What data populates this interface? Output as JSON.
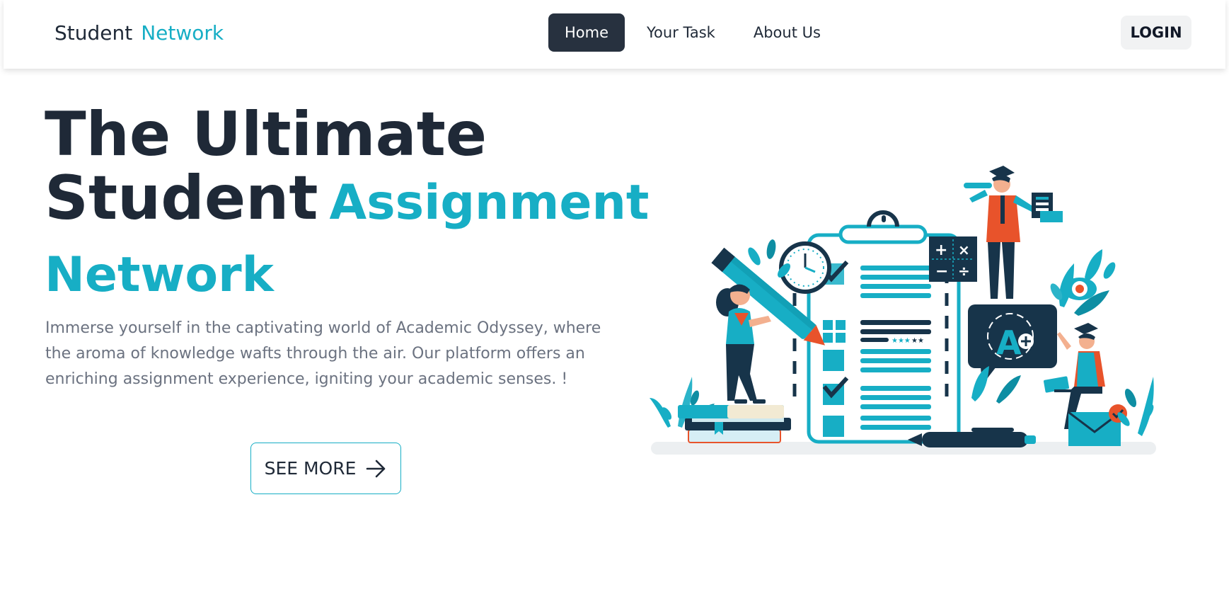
{
  "brand": {
    "part1": "Student",
    "part2": "Network"
  },
  "nav": {
    "items": [
      {
        "label": "Home",
        "active": true
      },
      {
        "label": "Your Task",
        "active": false
      },
      {
        "label": "About Us",
        "active": false
      }
    ]
  },
  "login": {
    "label": "LOGIN"
  },
  "hero": {
    "title_line1": "The Ultimate",
    "title_line2_dark": "Student",
    "title_line2_accent": "Assignment",
    "title_line3_accent": "Network",
    "description": "Immerse yourself in the captivating world of Academic Odyssey, where the aroma of knowledge wafts through the air. Our platform offers an enriching assignment experience, igniting your academic senses. !",
    "cta_label": "SEE MORE",
    "cta_icon": "arrow-right-icon"
  },
  "illustration": {
    "badge_letter": "A",
    "calculator_symbols": [
      "+",
      "×",
      "−",
      "÷"
    ]
  },
  "colors": {
    "accent": "#17aec5",
    "dark": "#1f2937",
    "nav_active_bg": "#27313f",
    "muted_text": "#6b7280",
    "orange": "#e8532b"
  }
}
